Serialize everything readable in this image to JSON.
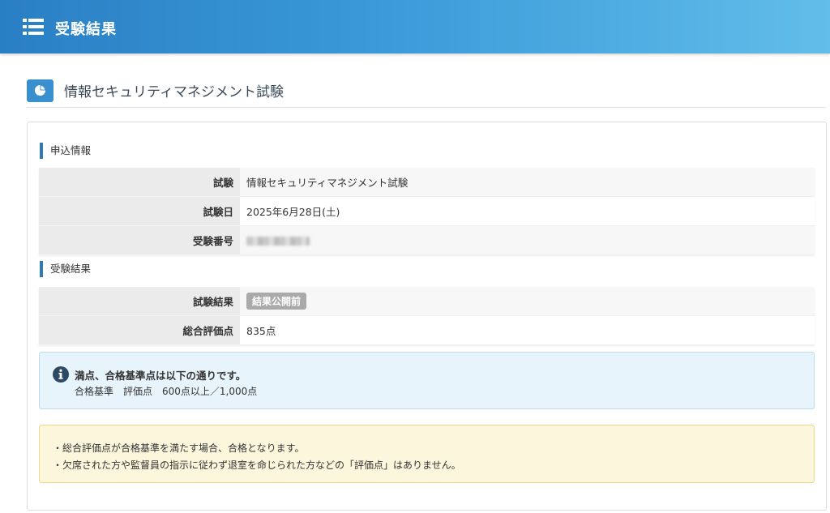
{
  "header": {
    "title": "受験結果",
    "icon": "list-menu-icon"
  },
  "page": {
    "title": "情報セキュリティマネジメント試験",
    "icon": "pie-chart-icon"
  },
  "application_section": {
    "title": "申込情報",
    "rows": [
      {
        "label": "試験",
        "value": "情報セキュリティマネジメント試験"
      },
      {
        "label": "試験日",
        "value": "2025年6月28日(土)"
      },
      {
        "label": "受験番号",
        "value": ""
      }
    ]
  },
  "result_section": {
    "title": "受験結果",
    "rows": [
      {
        "label": "試験結果",
        "value": "結果公開前"
      },
      {
        "label": "総合評価点",
        "value": "835点"
      }
    ]
  },
  "info_alert": {
    "icon": "info-circle-icon",
    "heading": "満点、合格基準点は以下の通りです。",
    "detail": "合格基準　評価点　600点以上／1,000点"
  },
  "notes": [
    "・総合評価点が合格基準を満たす場合、合格となります。",
    "・欠席された方や監督員の指示に従わず退室を命じられた方などの「評価点」はありません。"
  ],
  "colors": {
    "header_start": "#2a7fc4",
    "header_end": "#62bde9",
    "accent": "#2f7ab8",
    "status_badge": "#aaaaaa"
  }
}
